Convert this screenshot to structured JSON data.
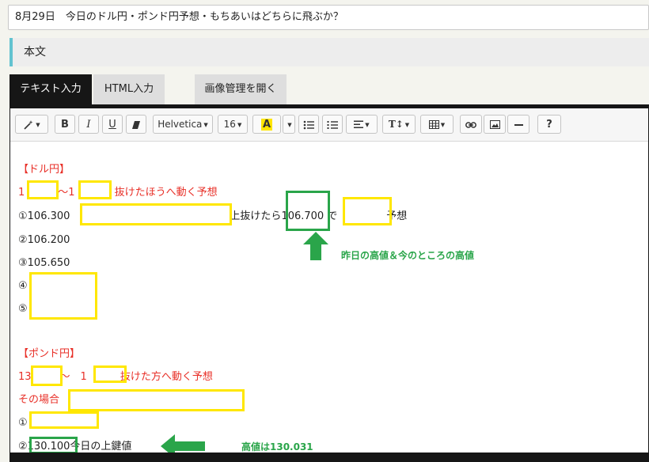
{
  "title": "8月29日　今日のドル円・ポンド円予想・もちあいはどちらに飛ぶか？",
  "section_label": "本文",
  "tabs": {
    "text_input": "テキスト入力",
    "html_input": "HTML入力",
    "image_manager": "画像管理を開く"
  },
  "toolbar": {
    "magic": "",
    "bold": "B",
    "italic": "I",
    "underline": "U",
    "font_family": "Helvetica",
    "font_size": "16",
    "font_color": "A",
    "help": "?"
  },
  "content": {
    "usd_heading": "【ドル円】",
    "usd_range_a": "1",
    "usd_range_mid": "〜1",
    "usd_breakout": "抜けたほうへ動く予想",
    "usd_line1_prefix": "①106.300",
    "usd_line1_mid": "上抜けたら",
    "usd_line1_value": "106.700",
    "usd_line1_de": "で",
    "usd_line1_suffix": "予想",
    "usd_line2": "②106.200",
    "usd_line3": "③105.650",
    "usd_line4": "④",
    "usd_line5": "⑤",
    "gbp_heading": "【ポンド円】",
    "gbp_range_a": "13",
    "gbp_range_mid": "〜　1",
    "gbp_breakout": "抜けた方へ動く予想",
    "gbp_case": "その場合",
    "gbp_line1": "①",
    "gbp_line2_prefix": "②",
    "gbp_line2_value": "130.100",
    "gbp_line2_suffix": "今日の上鍵値"
  },
  "annotations": {
    "usd_high_note": "昨日の高値＆今のところの高値",
    "gbp_high_note": "高値は130.031"
  },
  "colors": {
    "accent_teal": "#62c3d0",
    "highlight_yellow": "#ffe700",
    "annotation_green": "#2aa54a",
    "text_red": "#e83028"
  }
}
